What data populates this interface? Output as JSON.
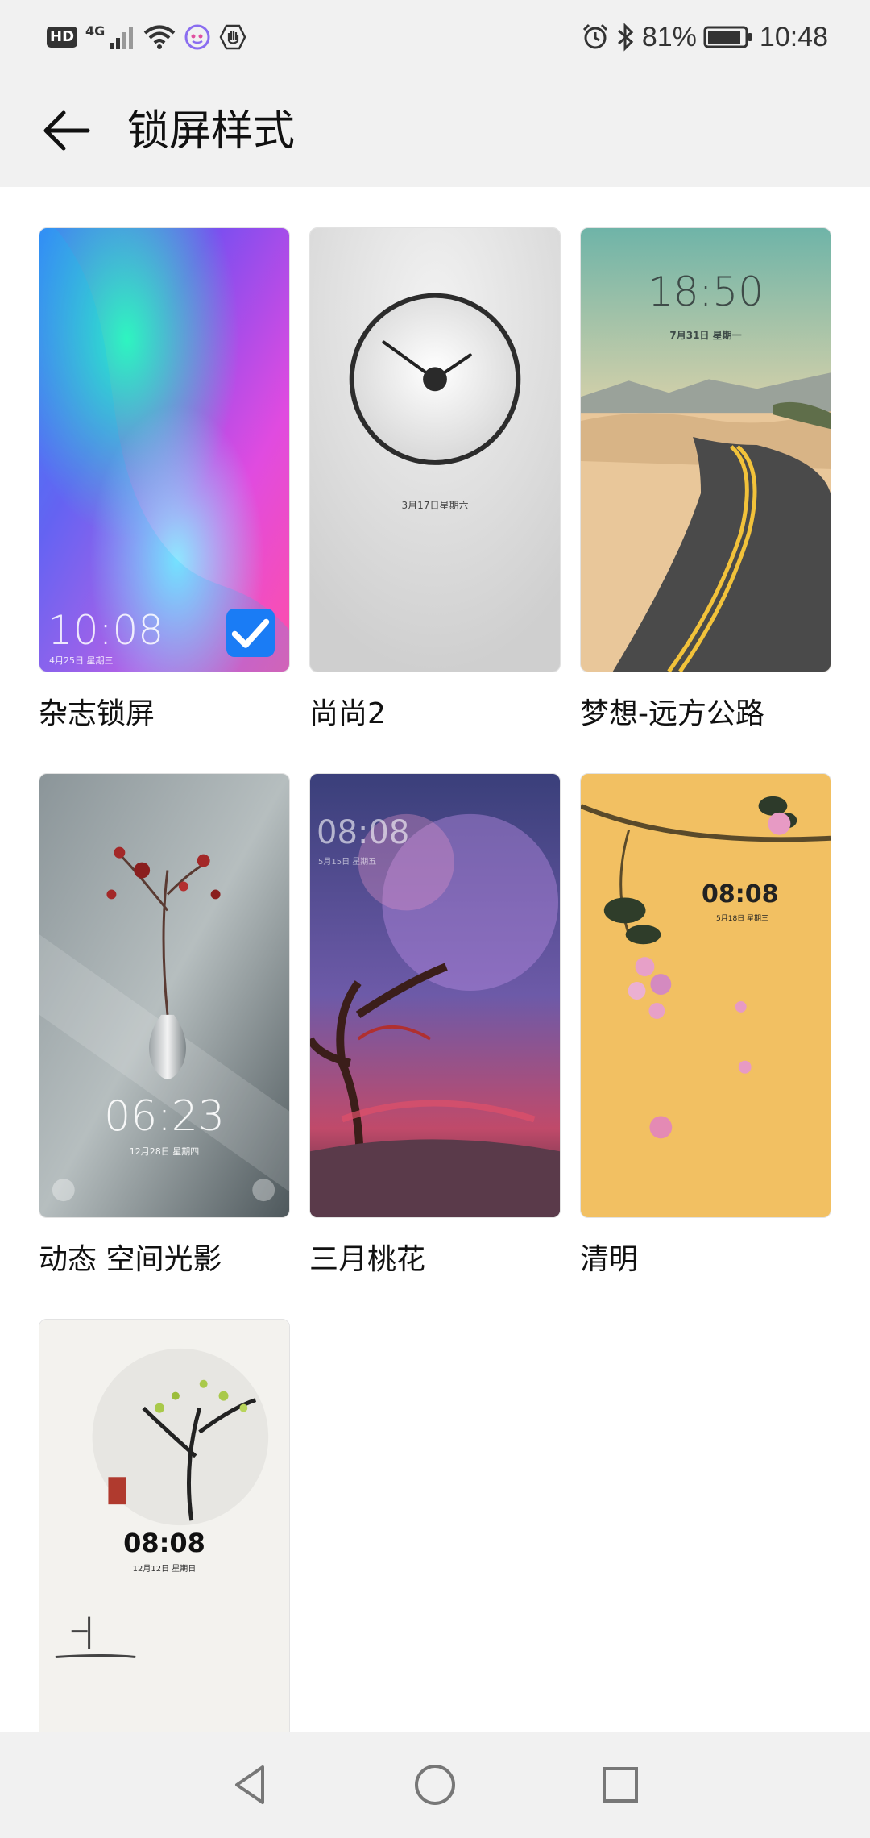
{
  "status_bar": {
    "hd": "HD",
    "network": "4G",
    "battery_percent": "81%",
    "time": "10:48",
    "icons": [
      "hd-icon",
      "signal-icon",
      "wifi-icon",
      "assistant-icon",
      "hand-icon",
      "alarm-icon",
      "bluetooth-icon",
      "battery-icon"
    ]
  },
  "header": {
    "title": "锁屏样式"
  },
  "styles": [
    {
      "name": "杂志锁屏",
      "selected": true,
      "preview_time": "10:08",
      "preview_date": "4月25日 星期三"
    },
    {
      "name": "尚尚2",
      "selected": false,
      "preview_time": "",
      "preview_date": "3月17日星期六"
    },
    {
      "name": "梦想-远方公路",
      "selected": false,
      "preview_time": "18:50",
      "preview_date": "7月31日  星期一"
    },
    {
      "name": "动态 空间光影",
      "selected": false,
      "preview_time": "06:23",
      "preview_date": "12月28日  星期四"
    },
    {
      "name": "三月桃花",
      "selected": false,
      "preview_time": "08:08",
      "preview_date": "5月15日 星期五"
    },
    {
      "name": "清明",
      "selected": false,
      "preview_time": "08:08",
      "preview_date": "5月18日  星期三"
    },
    {
      "name": "",
      "selected": false,
      "preview_time": "08:08",
      "preview_date": "12月12日  星期日"
    }
  ],
  "nav_bar": {
    "icons": [
      "back-triangle-icon",
      "home-circle-icon",
      "recents-square-icon"
    ]
  },
  "colors": {
    "accent": "#1a7cf5",
    "background": "#f1f1f1",
    "surface": "#ffffff"
  }
}
